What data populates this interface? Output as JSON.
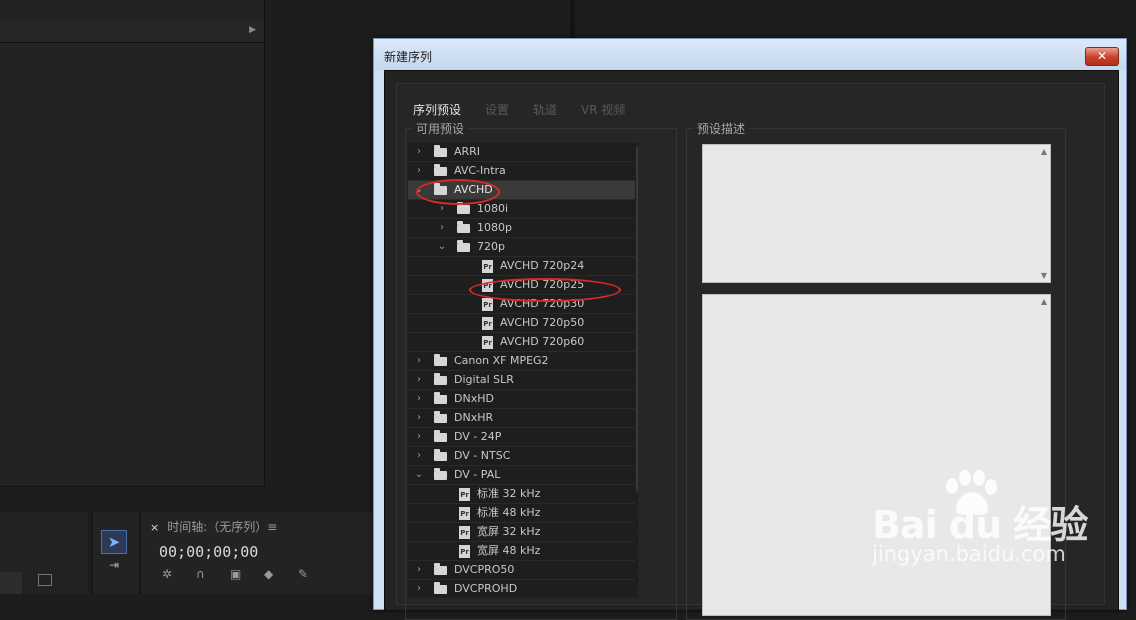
{
  "dialog": {
    "title": "新建序列",
    "close_label": "✕",
    "tabs": [
      {
        "label": "序列预设"
      },
      {
        "label": "设置"
      },
      {
        "label": "轨道"
      },
      {
        "label": "VR 视频"
      }
    ],
    "available_presets_label": "可用预设",
    "preset_description_label": "预设描述",
    "tree": [
      {
        "label": "ARRI",
        "type": "folder",
        "level": 0,
        "expanded": false
      },
      {
        "label": "AVC-Intra",
        "type": "folder",
        "level": 0,
        "expanded": false
      },
      {
        "label": "AVCHD",
        "type": "folder",
        "level": 0,
        "expanded": true,
        "selected": true
      },
      {
        "label": "1080i",
        "type": "folder",
        "level": 1,
        "expanded": false
      },
      {
        "label": "1080p",
        "type": "folder",
        "level": 1,
        "expanded": false
      },
      {
        "label": "720p",
        "type": "folder",
        "level": 1,
        "expanded": true
      },
      {
        "label": "AVCHD 720p24",
        "type": "preset",
        "level": 2
      },
      {
        "label": "AVCHD 720p25",
        "type": "preset",
        "level": 2
      },
      {
        "label": "AVCHD 720p30",
        "type": "preset",
        "level": 2
      },
      {
        "label": "AVCHD 720p50",
        "type": "preset",
        "level": 2
      },
      {
        "label": "AVCHD 720p60",
        "type": "preset",
        "level": 2
      },
      {
        "label": "Canon XF MPEG2",
        "type": "folder",
        "level": 0,
        "expanded": false
      },
      {
        "label": "Digital SLR",
        "type": "folder",
        "level": 0,
        "expanded": false
      },
      {
        "label": "DNxHD",
        "type": "folder",
        "level": 0,
        "expanded": false
      },
      {
        "label": "DNxHR",
        "type": "folder",
        "level": 0,
        "expanded": false
      },
      {
        "label": "DV - 24P",
        "type": "folder",
        "level": 0,
        "expanded": false
      },
      {
        "label": "DV - NTSC",
        "type": "folder",
        "level": 0,
        "expanded": false
      },
      {
        "label": "DV - PAL",
        "type": "folder",
        "level": 0,
        "expanded": true
      },
      {
        "label": "标准 32 kHz",
        "type": "preset",
        "level": 1
      },
      {
        "label": "标准 48 kHz",
        "type": "preset",
        "level": 1
      },
      {
        "label": "宽屏 32 kHz",
        "type": "preset",
        "level": 1
      },
      {
        "label": "宽屏 48 kHz",
        "type": "preset",
        "level": 1
      },
      {
        "label": "DVCPRO50",
        "type": "folder",
        "level": 0,
        "expanded": false
      },
      {
        "label": "DVCPROHD",
        "type": "folder",
        "level": 0,
        "expanded": false
      }
    ],
    "pr_icon_label": "Pr"
  },
  "timeline": {
    "close_label": "×",
    "tab_label": "时间轴:（无序列）≡",
    "timecode": "00;00;00;00"
  },
  "watermark": {
    "brand": "Bai du 经验",
    "url": "jingyan.baidu.com"
  },
  "colors": {
    "accent": "#2d8ceb",
    "annotation": "#d82a2a",
    "app_bg": "#1d1d1d",
    "dialog_frame": "#cfe0f3"
  }
}
